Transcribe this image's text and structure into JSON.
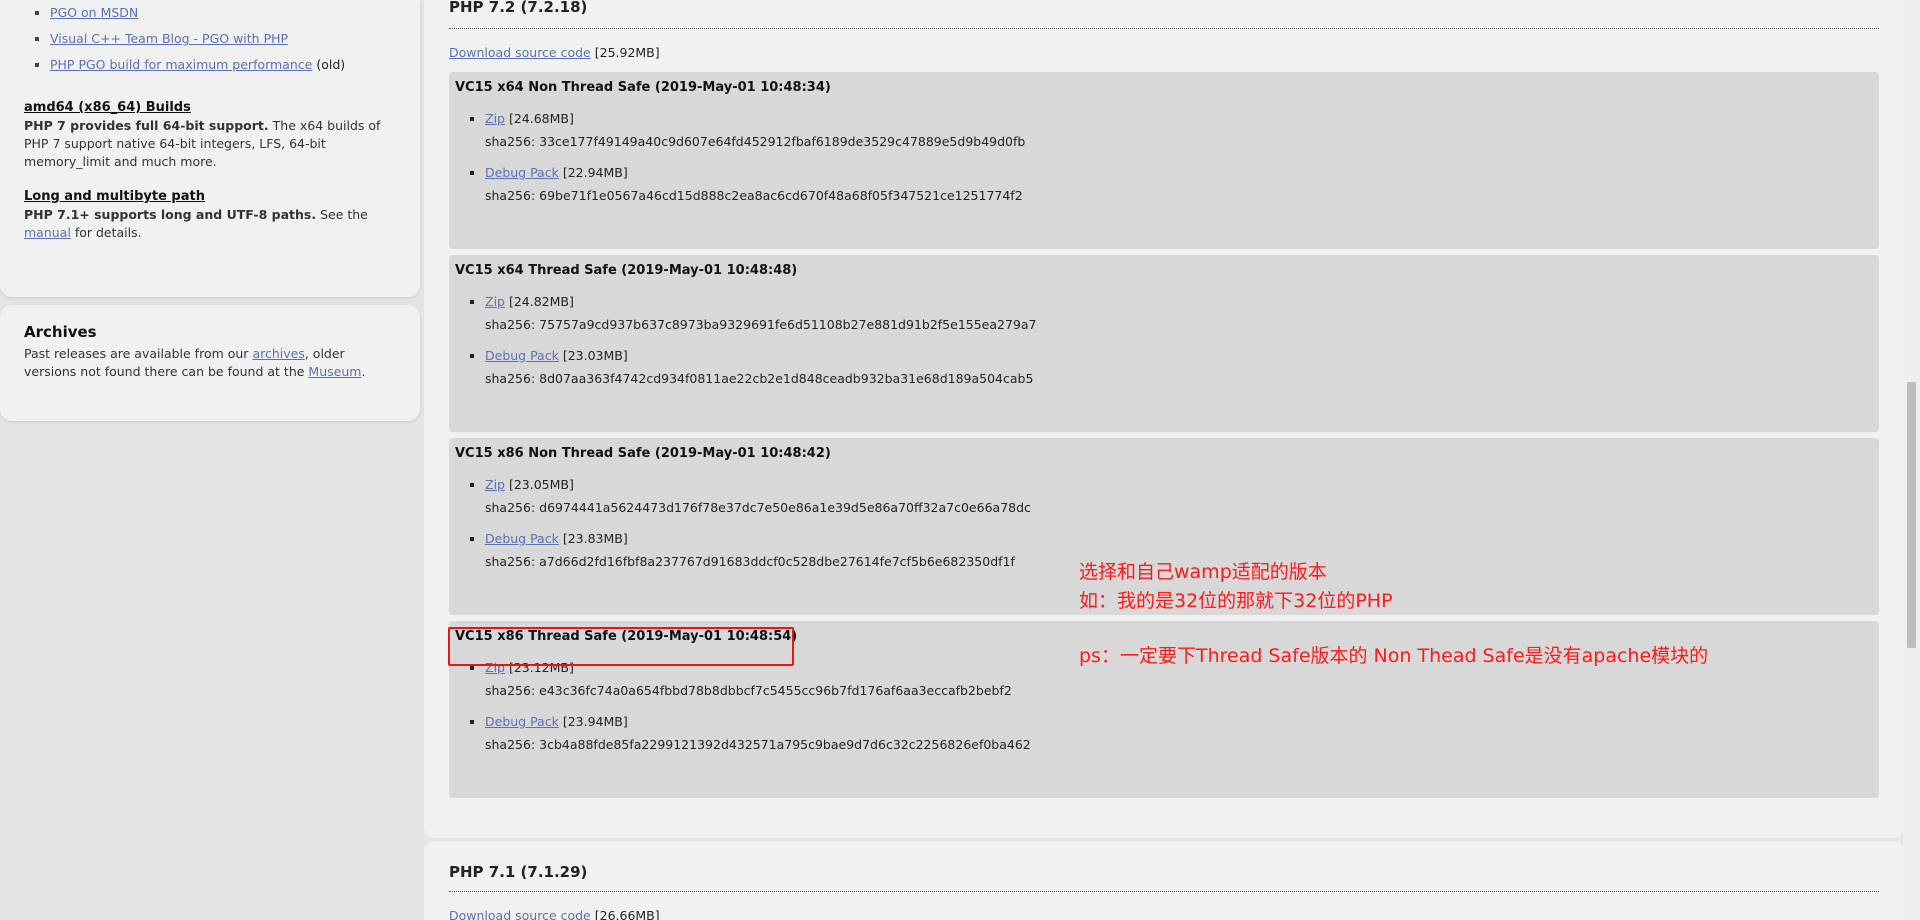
{
  "sidebar": {
    "pgo_links": [
      {
        "text": "PGO on MSDN",
        "suffix": ""
      },
      {
        "text": "Visual C++ Team Blog - PGO with PHP",
        "suffix": ""
      },
      {
        "text": "PHP PGO build for maximum performance",
        "suffix": "(old)"
      }
    ],
    "amd64": {
      "heading": "amd64 (x86_64) Builds",
      "bold": "PHP 7 provides full 64-bit support.",
      "text": "The x64 builds of PHP 7 support native 64-bit integers, LFS, 64-bit memory_limit and much more."
    },
    "long_path": {
      "heading": "Long and multibyte path",
      "bold": "PHP 7.1+ supports long and UTF-8 paths.",
      "text_before": "See the",
      "link": "manual",
      "text_after": "for details."
    },
    "archives": {
      "title": "Archives",
      "text_1": "Past releases are available from our",
      "link_1": "archives",
      "text_2": ", older versions not found there can be found at the",
      "link_2": "Museum",
      "text_3": "."
    }
  },
  "release": {
    "title": "PHP 7.2 (7.2.18)",
    "download_link": "Download source code",
    "download_size": "[25.92MB]",
    "builds": [
      {
        "title": "VC15 x64 Non Thread Safe (2019-May-01 10:48:34)",
        "zip_label": "Zip",
        "zip_size": "[24.68MB]",
        "zip_sha": "sha256: 33ce177f49149a40c9d607e64fd452912fbaf6189de3529c47889e5d9b49d0fb",
        "debug_label": "Debug Pack",
        "debug_size": "[22.94MB]",
        "debug_sha": "sha256: 69be71f1e0567a46cd15d888c2ea8ac6cd670f48a68f05f347521ce1251774f2"
      },
      {
        "title": "VC15 x64 Thread Safe (2019-May-01 10:48:48)",
        "zip_label": "Zip",
        "zip_size": "[24.82MB]",
        "zip_sha": "sha256: 75757a9cd937b637c8973ba9329691fe6d51108b27e881d91b2f5e155ea279a7",
        "debug_label": "Debug Pack",
        "debug_size": "[23.03MB]",
        "debug_sha": "sha256: 8d07aa363f4742cd934f0811ae22cb2e1d848ceadb932ba31e68d189a504cab5"
      },
      {
        "title": "VC15 x86 Non Thread Safe (2019-May-01 10:48:42)",
        "zip_label": "Zip",
        "zip_size": "[23.05MB]",
        "zip_sha": "sha256: d6974441a5624473d176f78e37dc7e50e86a1e39d5e86a70ff32a7c0e66a78dc",
        "debug_label": "Debug Pack",
        "debug_size": "[23.83MB]",
        "debug_sha": "sha256: a7d66d2fd16fbf8a237767d91683ddcf0c528dbe27614fe7cf5b6e682350df1f"
      },
      {
        "title": "VC15 x86 Thread Safe (2019-May-01 10:48:54)",
        "zip_label": "Zip",
        "zip_size": "[23.12MB]",
        "zip_sha": "sha256: e43c36fc74a0a654fbbd78b8dbbcf7c5455cc96b7fd176af6aa3eccafb2bebf2",
        "debug_label": "Debug Pack",
        "debug_size": "[23.94MB]",
        "debug_sha": "sha256: 3cb4a88fde85fa2299121392d432571a795c9bae9d7d6c32c2256826ef0ba462"
      }
    ]
  },
  "next_release": {
    "title": "PHP 7.1 (7.1.29)",
    "download_link": "Download source code",
    "download_size": "[26.66MB]"
  },
  "annotations": {
    "line1": "选择和自己wamp适配的版本",
    "line2": "如：我的是32位的那就下32位的PHP",
    "line3": "ps：一定要下Thread Safe版本的 Non Thead Safe是没有apache模块的"
  },
  "colors": {
    "annotation": "#ff1a1a",
    "link": "#5b70b2",
    "build_bg": "#d8d8d8"
  }
}
